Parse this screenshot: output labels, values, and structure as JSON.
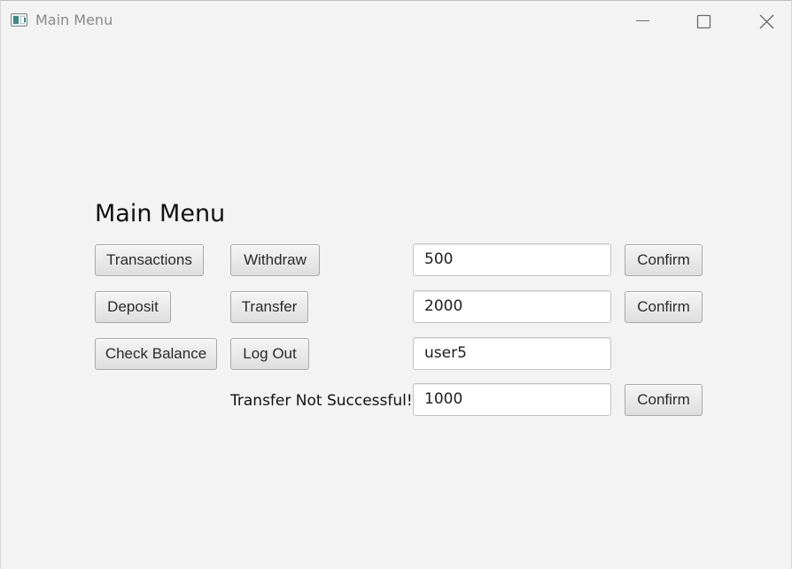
{
  "window": {
    "title": "Main Menu"
  },
  "main": {
    "heading": "Main Menu",
    "buttons": {
      "transactions": "Transactions",
      "withdraw": "Withdraw",
      "deposit": "Deposit",
      "transfer": "Transfer",
      "check_balance": "Check Balance",
      "log_out": "Log Out"
    },
    "fields": {
      "withdraw_amount": "500",
      "transfer_amount": "2000",
      "transfer_recipient": "user5",
      "extra_amount": "1000"
    },
    "confirm_labels": {
      "withdraw": "Confirm",
      "transfer": "Confirm",
      "extra": "Confirm"
    },
    "status_message": "Transfer Not Successful!"
  },
  "icons": {
    "app": "app-window-icon",
    "minimize": "minimize-icon",
    "maximize": "maximize-icon",
    "close": "close-icon"
  }
}
